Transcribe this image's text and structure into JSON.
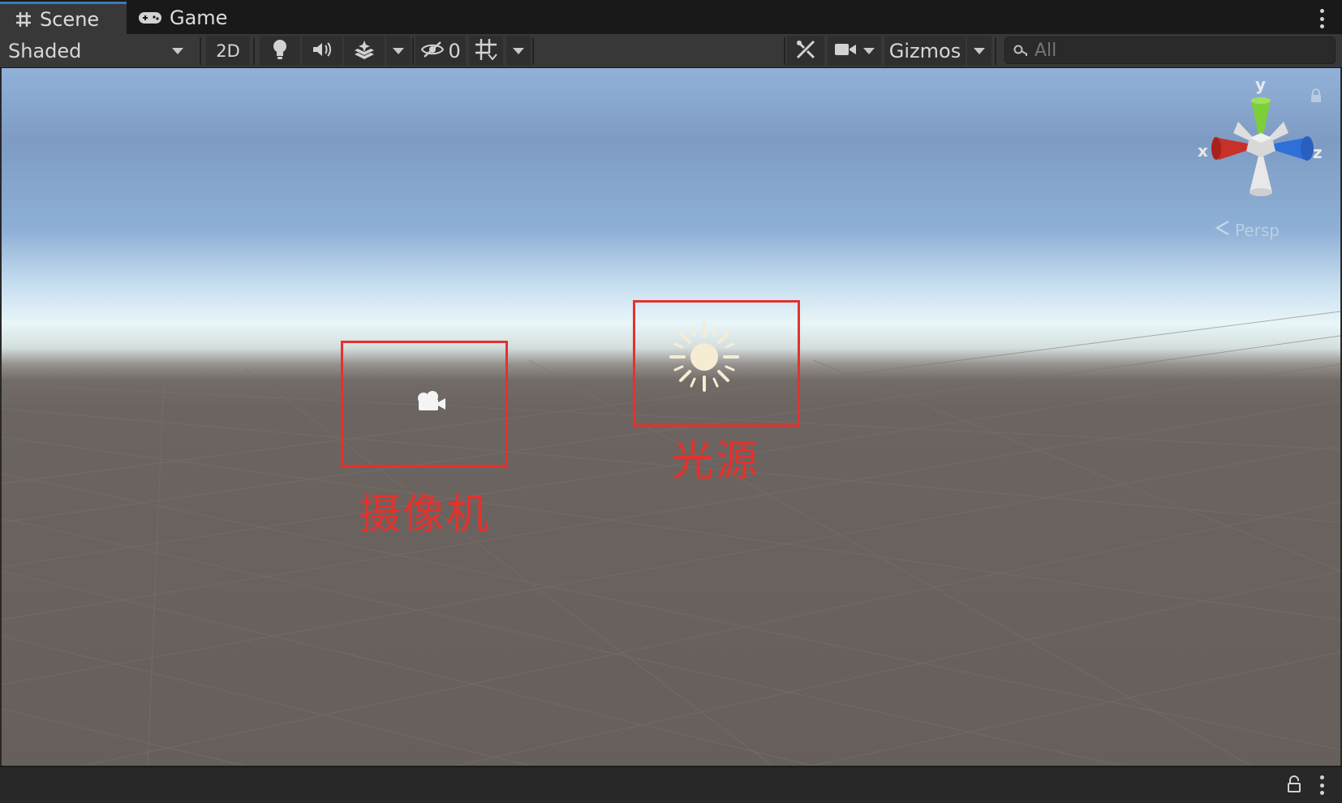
{
  "tabs": [
    {
      "label": "Scene",
      "icon": "grid-icon",
      "active": true
    },
    {
      "label": "Game",
      "icon": "gamepad-icon",
      "active": false
    }
  ],
  "toolbar": {
    "draw_mode": "Shaded",
    "mode_2d": "2D",
    "hidden_count": "0",
    "gizmos_label": "Gizmos",
    "search_placeholder": "All"
  },
  "viewport": {
    "camera_annotation": "摄像机",
    "light_annotation": "光源",
    "axes": {
      "x": "x",
      "y": "y",
      "z": "z"
    },
    "projection_label": "Persp"
  },
  "colors": {
    "annotation": "#e3322d",
    "axis_x": "#c8302a",
    "axis_y": "#7ccf3a",
    "axis_z": "#2f6fd8",
    "tab_accent": "#3a79bb"
  }
}
